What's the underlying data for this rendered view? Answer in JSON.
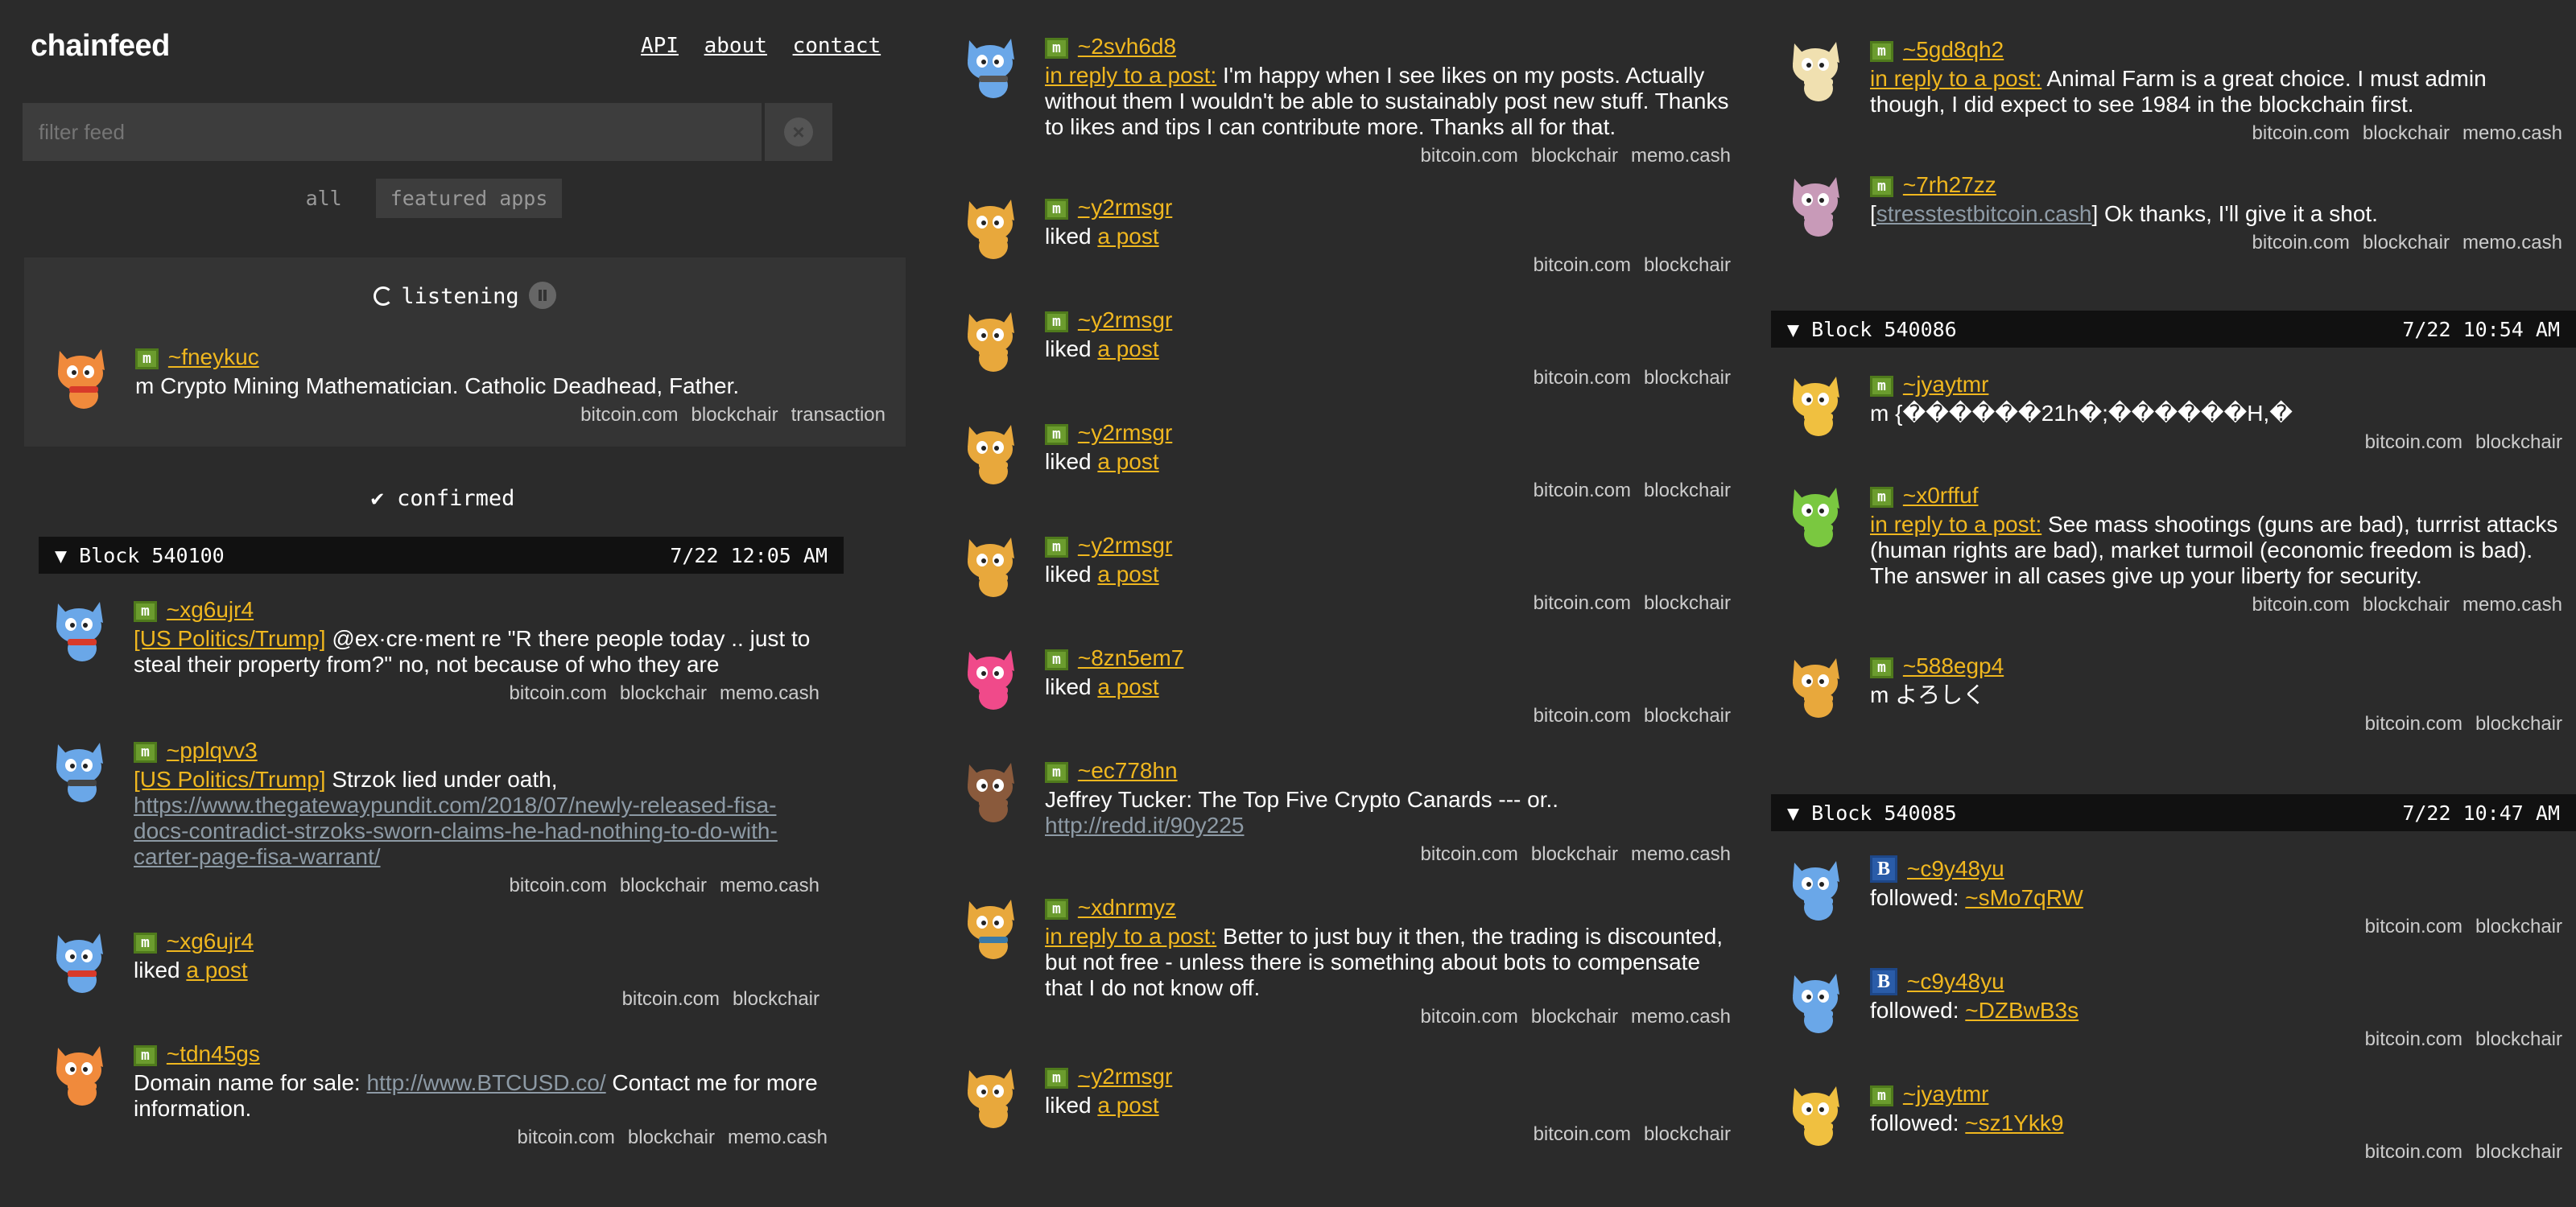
{
  "header": {
    "logo": "chainfeed",
    "nav": [
      "API",
      "about",
      "contact"
    ],
    "filter_placeholder": "filter feed",
    "tabs": [
      "all",
      "featured apps"
    ]
  },
  "status": {
    "listening": "listening",
    "confirmed": "confirmed"
  },
  "listening_post": {
    "user": "~fneykuc",
    "text": "m Crypto Mining Mathematician. Catholic Deadhead, Father.",
    "links": [
      "bitcoin.com",
      "blockchair",
      "transaction"
    ]
  },
  "blocks": [
    {
      "title": "▼ Block 540100",
      "time": "7/22 12:05 AM"
    },
    {
      "title": "▼ Block 540086",
      "time": "7/22 10:54 AM"
    },
    {
      "title": "▼ Block 540085",
      "time": "7/22 10:47 AM"
    }
  ],
  "col1_posts": [
    {
      "user": "~xg6ujr4",
      "cat": "[US Politics/Trump]",
      "text": " @ex·cre·ment re \"R there people today .. just to steal their property from?\" no, not because of who they are",
      "links": [
        "bitcoin.com",
        "blockchair",
        "memo.cash"
      ]
    },
    {
      "user": "~pplqvv3",
      "cat": "[US Politics/Trump]",
      "text": " Strzok lied under oath,",
      "url": "https://www.thegatewaypundit.com/2018/07/newly-released-fisa-docs-contradict-strzoks-sworn-claims-he-had-nothing-to-do-with-carter-page-fisa-warrant/",
      "links": [
        "bitcoin.com",
        "blockchair",
        "memo.cash"
      ]
    },
    {
      "user": "~xg6ujr4",
      "pre": "liked ",
      "link": "a post",
      "links": [
        "bitcoin.com",
        "blockchair"
      ]
    },
    {
      "user": "~tdn45gs",
      "pre": "Domain name for sale: ",
      "url": "http://www.BTCUSD.co/",
      "text": " Contact me for more information.",
      "links": [
        "bitcoin.com",
        "blockchair",
        "memo.cash"
      ]
    }
  ],
  "col2_posts": [
    {
      "user": "~2svh6d8",
      "reply": "in reply to a post:",
      "text": " I'm happy when I see likes on my posts. Actually without them I wouldn't be able to sustainably post new stuff. Thanks to likes and tips I can contribute more. Thanks all for that.",
      "links": [
        "bitcoin.com",
        "blockchair",
        "memo.cash"
      ]
    },
    {
      "user": "~y2rmsgr",
      "pre": "liked ",
      "link": "a post",
      "links": [
        "bitcoin.com",
        "blockchair"
      ]
    },
    {
      "user": "~y2rmsgr",
      "pre": "liked ",
      "link": "a post",
      "links": [
        "bitcoin.com",
        "blockchair"
      ]
    },
    {
      "user": "~y2rmsgr",
      "pre": "liked ",
      "link": "a post",
      "links": [
        "bitcoin.com",
        "blockchair"
      ]
    },
    {
      "user": "~y2rmsgr",
      "pre": "liked ",
      "link": "a post",
      "links": [
        "bitcoin.com",
        "blockchair"
      ]
    },
    {
      "user": "~8zn5em7",
      "pre": "liked ",
      "link": "a post",
      "links": [
        "bitcoin.com",
        "blockchair"
      ]
    },
    {
      "user": "~ec778hn",
      "text": "Jeffrey Tucker: The Top Five Crypto Canards --- or..",
      "url": "http://redd.it/90y225",
      "links": [
        "bitcoin.com",
        "blockchair",
        "memo.cash"
      ]
    },
    {
      "user": "~xdnrmyz",
      "reply": "in reply to a post:",
      "text": " Better to just buy it then, the trading is discounted, but not free - unless there is something about bots to compensate that I do not know off.",
      "links": [
        "bitcoin.com",
        "blockchair",
        "memo.cash"
      ]
    },
    {
      "user": "~y2rmsgr",
      "pre": "liked ",
      "link": "a post",
      "links": [
        "bitcoin.com",
        "blockchair"
      ]
    }
  ],
  "col3_posts": [
    {
      "user": "~5gd8qh2",
      "reply": "in reply to a post:",
      "text": " Animal Farm is a great choice. I must admin though, I did expect to see 1984 in the blockchain first.",
      "links": [
        "bitcoin.com",
        "blockchair",
        "memo.cash"
      ]
    },
    {
      "user": "~7rh27zz",
      "pre": "[",
      "url": "stresstestbitcoin.cash",
      "text": "] Ok thanks, I'll give it a shot.",
      "links": [
        "bitcoin.com",
        "blockchair",
        "memo.cash"
      ]
    },
    {
      "user": "~jyaytmr",
      "text": "m {������21h�;������H,�",
      "links": [
        "bitcoin.com",
        "blockchair"
      ]
    },
    {
      "user": "~x0rffuf",
      "reply": "in reply to a post:",
      "text": " See mass shootings (guns are bad), turrrist attacks (human rights are bad), market turmoil (economic freedom is bad). The answer in all cases give up your liberty for security.",
      "links": [
        "bitcoin.com",
        "blockchair",
        "memo.cash"
      ]
    },
    {
      "user": "~588egp4",
      "text": "m よろしく",
      "links": [
        "bitcoin.com",
        "blockchair"
      ]
    },
    {
      "user": "~c9y48yu",
      "badge": "B",
      "pre": "followed: ",
      "link": "~sMo7qRW",
      "links": [
        "bitcoin.com",
        "blockchair"
      ]
    },
    {
      "user": "~c9y48yu",
      "badge": "B",
      "pre": "followed: ",
      "link": "~DZBwB3s",
      "links": [
        "bitcoin.com",
        "blockchair"
      ]
    },
    {
      "user": "~jyaytmr",
      "pre": "followed: ",
      "link": "~sz1Ykk9",
      "links": [
        "bitcoin.com",
        "blockchair"
      ]
    }
  ],
  "badge_memo": "m",
  "colors": {
    "background": "#2b2b2b",
    "link": "#f0b71f",
    "url": "#8d9aa5",
    "badge_memo": "#6b9c2e",
    "badge_b": "#2a5ca8"
  }
}
